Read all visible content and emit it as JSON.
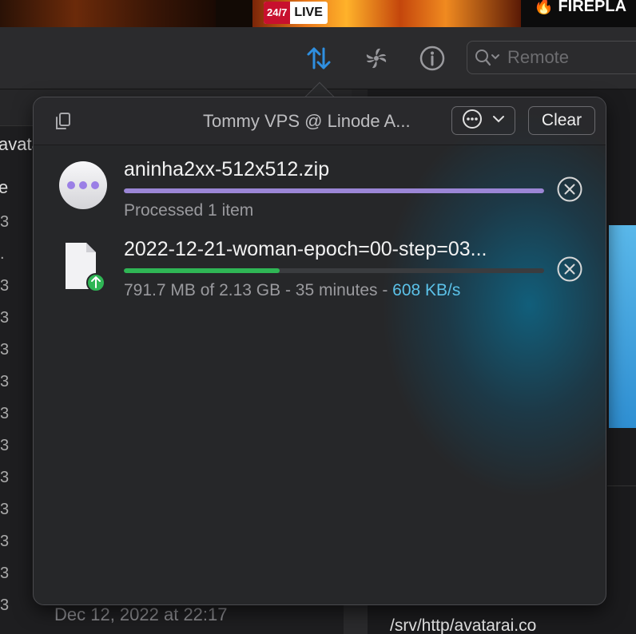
{
  "background": {
    "live_badge": {
      "left": "24/7",
      "right": "LIVE"
    },
    "right_title": "🔥 FIREPLA",
    "left_snippets": {
      "avata": "avata",
      "e": "e"
    },
    "left_row_glyphs": [
      "3",
      ".",
      "3",
      "3",
      "3",
      "3",
      "3",
      "3",
      "3",
      "3",
      "3",
      "3",
      "3"
    ],
    "date": "Dec 12, 2022 at 22:17",
    "path": "/srv/http/avatarai.co"
  },
  "toolbar": {
    "icons": [
      "transfer-arrows-icon",
      "fan-activity-icon",
      "info-icon"
    ],
    "search": {
      "placeholder": "Remote",
      "value": ""
    },
    "accent_color": "#2f8fe0"
  },
  "popover": {
    "title": "Tommy VPS @ Linode A...",
    "clear_label": "Clear",
    "items": [
      {
        "name": "aninha2xx-512x512.zip",
        "status": "Processed 1 item",
        "progress": 1.0,
        "bar_color": "#9b86d6",
        "icon": "ellipsis-circle-icon"
      },
      {
        "name": "2022-12-21-woman-epoch=00-step=03...",
        "status_prefix": "791.7 MB of 2.13 GB - 35 minutes - ",
        "speed": "608 KB/s",
        "progress": 0.37,
        "bar_color": "#2fb655",
        "icon": "file-upload-icon"
      }
    ]
  }
}
